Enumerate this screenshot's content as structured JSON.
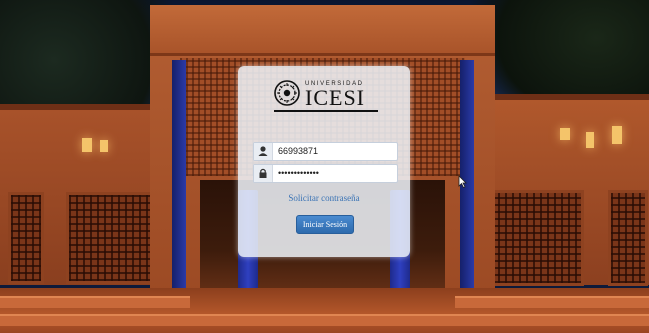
{
  "logo": {
    "university_label": "UNIVERSIDAD",
    "name": "ICESI",
    "seal_icon": "university-seal-icon"
  },
  "form": {
    "username": {
      "icon": "user-icon",
      "value": "66993871"
    },
    "password": {
      "icon": "lock-icon",
      "value": "•••••••••••••"
    },
    "forgot_link": "Solicitar contraseña",
    "submit_label": "Iniciar Sesión"
  },
  "colors": {
    "accent": "#3b73b5",
    "button": "#2e6aad",
    "brick": "#a9542a",
    "pillar": "#2f40c0"
  }
}
